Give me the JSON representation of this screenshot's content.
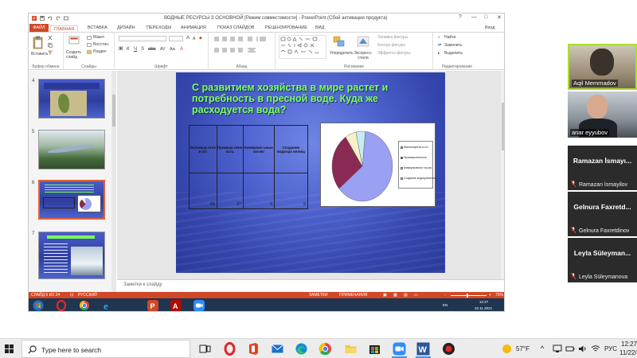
{
  "window": {
    "title": "ВОДНЫЕ РЕСУРСЫ З ОСНОВНОЙ [Режим совместимости] - PowerPoint (Сбой активации продукта)",
    "controls": [
      "?",
      "—",
      "□",
      "✕"
    ]
  },
  "ribbon_tabs": {
    "file": "ФАЙЛ",
    "home": "ГЛАВНАЯ",
    "items": [
      "ВСТАВКА",
      "ДИЗАЙН",
      "ПЕРЕХОДЫ",
      "АНИМАЦИЯ",
      "ПОКАЗ СЛАЙДОВ",
      "РЕЦЕНЗИРОВАНИЕ",
      "ВИД"
    ],
    "signin": "Вход"
  },
  "ribbon": {
    "clipboard": {
      "paste": "Вставить",
      "cut": "Копир...",
      "label": "Буфер обмена"
    },
    "slides": {
      "new_slide": "Создать слайд",
      "layout": "Макет",
      "reset": "Восстан.",
      "section": "Раздел",
      "label": "Слайды"
    },
    "font": {
      "label": "Шрифт"
    },
    "paragraph": {
      "label": "Абзац"
    },
    "drawing": {
      "arrange": "Упорядочить",
      "quick_styles": "Экспресс-стили",
      "fill": "Заливка фигуры",
      "outline": "Контур фигуры",
      "effects": "Эффекты фигуры",
      "label": "Рисование"
    },
    "editing": {
      "find": "Найти",
      "replace": "Заменить",
      "select": "Выделить",
      "label": "Редактирование"
    }
  },
  "thumbnails": [
    {
      "num": "4",
      "selected": false
    },
    {
      "num": "5",
      "selected": false
    },
    {
      "num": "6",
      "selected": true
    },
    {
      "num": "7",
      "selected": false
    }
  ],
  "slide": {
    "title": "С развитием хозяйства в мире растет и потребность в пресной воде. Куда же расходуется вода?",
    "table": {
      "headers": [
        "Использу ется в с/х",
        "Промыш ленн ость",
        "Коммунал ьные хоз-во",
        "Создание водохра нилищ"
      ],
      "values": [
        "63",
        "27",
        "6",
        "5"
      ]
    },
    "legend": [
      "Используется в с/х",
      "Промышленность",
      "Коммунальное хоз-во",
      "Создание водохранилищ"
    ]
  },
  "chart_data": {
    "type": "pie",
    "categories": [
      "Используется в с/х",
      "Промышленность",
      "Коммунальное хоз-во",
      "Создание водохранилищ"
    ],
    "values": [
      63,
      27,
      6,
      5
    ],
    "colors": [
      "#9aa0f2",
      "#8a2a52",
      "#f6f1c6",
      "#c6ecf4"
    ]
  },
  "notes": {
    "placeholder": "Заметки к слайду"
  },
  "statusbar": {
    "slide_counter": "СЛАЙД 6 ИЗ 24",
    "language": "РУССКИЙ",
    "notes": "ЗАМЕТКИ",
    "comments": "ПРИМЕЧАНИЯ",
    "zoom": "75%"
  },
  "vm_taskbar": {
    "lang": "EN",
    "time": "12:27",
    "date": "22.11.2021"
  },
  "participants": [
    {
      "name": "Aqil Memmadov",
      "video": true
    },
    {
      "name": "anar eyyubov",
      "video": true
    },
    {
      "name": "Ramazan İsmayı...",
      "sub": "Ramazan İsmayilov",
      "video": false
    },
    {
      "name": "Gelnura Faxretd...",
      "sub": "Gelnura Faxretdinov",
      "video": false
    },
    {
      "name": "Leyla Süleyman...",
      "sub": "Leyla Süleymanova",
      "video": false
    }
  ],
  "taskbar": {
    "search_placeholder": "Type here to search",
    "weather": "57°F",
    "lang": "РУС",
    "time": "12:27",
    "date": "11/22/"
  }
}
